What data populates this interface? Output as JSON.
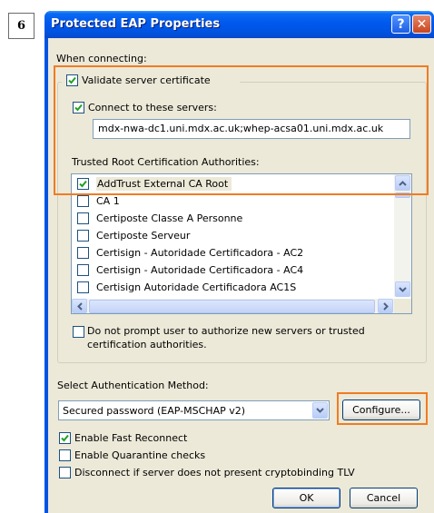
{
  "step_badge": "6",
  "window": {
    "title": "Protected EAP Properties",
    "help_label": "?",
    "close_label": "✕"
  },
  "when_connecting_label": "When connecting:",
  "validate_cert": {
    "label": "Validate server certificate",
    "checked": true
  },
  "connect_servers": {
    "label": "Connect to these servers:",
    "checked": true
  },
  "servers_value": "mdx-nwa-dc1.uni.mdx.ac.uk;whep-acsa01.uni.mdx.ac.uk",
  "trusted_root_label": "Trusted Root Certification Authorities:",
  "ca_list": [
    {
      "label": "AddTrust External CA Root",
      "checked": true
    },
    {
      "label": "CA 1",
      "checked": false
    },
    {
      "label": "Certiposte Classe A Personne",
      "checked": false
    },
    {
      "label": "Certiposte Serveur",
      "checked": false
    },
    {
      "label": "Certisign - Autoridade Certificadora - AC2",
      "checked": false
    },
    {
      "label": "Certisign - Autoridade Certificadora - AC4",
      "checked": false
    },
    {
      "label": "Certisign Autoridade Certificadora AC1S",
      "checked": false
    }
  ],
  "do_not_prompt": {
    "line1": "Do not prompt user to authorize new servers or trusted",
    "line2": "certification authorities.",
    "checked": false
  },
  "auth_method_label": "Select Authentication Method:",
  "auth_method_value": "Secured password (EAP-MSCHAP v2)",
  "configure_label": "Configure...",
  "fast_reconnect": {
    "label": "Enable Fast Reconnect",
    "checked": true
  },
  "quarantine": {
    "label": "Enable Quarantine checks",
    "checked": false
  },
  "cryptobinding": {
    "label": "Disconnect if server does not present cryptobinding TLV",
    "checked": false
  },
  "ok_label": "OK",
  "cancel_label": "Cancel",
  "colors": {
    "highlight": "#f07c22",
    "titlebar": "#0058ee",
    "dialog_bg": "#ece9d8"
  }
}
